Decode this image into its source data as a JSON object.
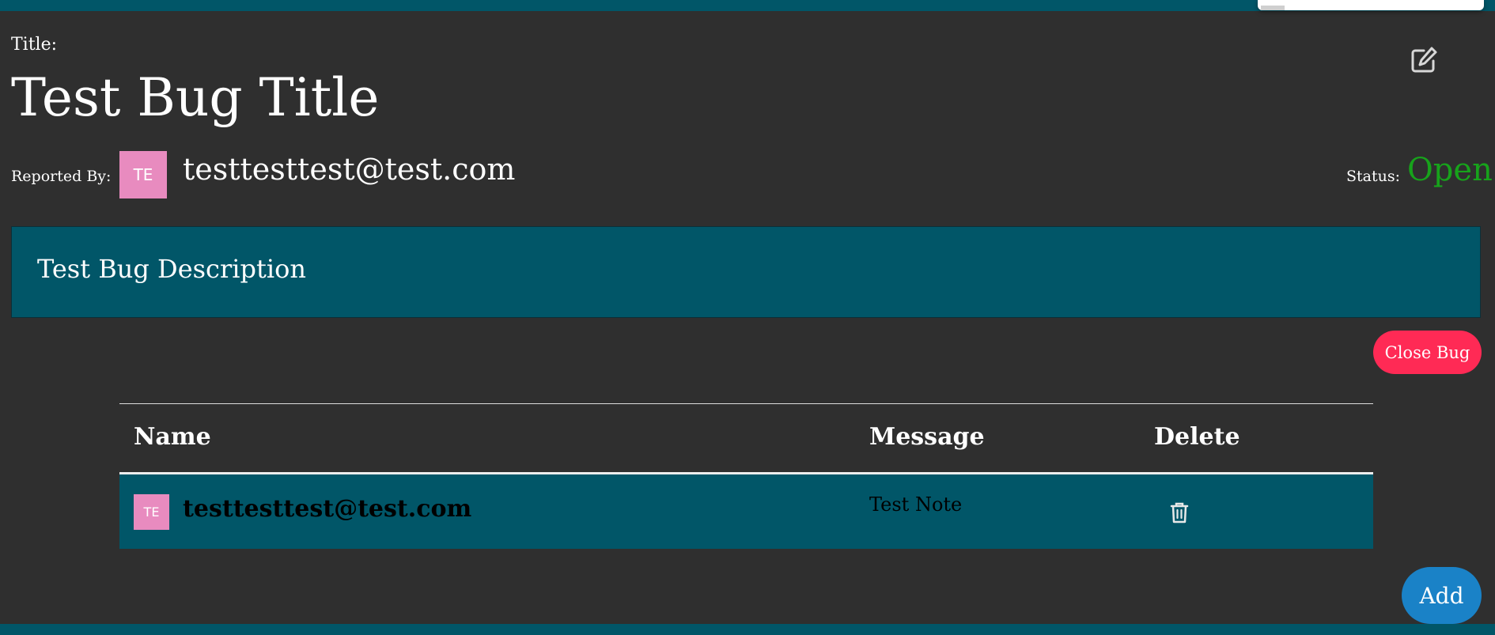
{
  "bug": {
    "title_label": "Title:",
    "title": "Test Bug Title",
    "reported_by_label": "Reported By:",
    "reporter_initials": "TE",
    "reporter_email": "testtesttest@test.com",
    "status_label": "Status:",
    "status": "Open",
    "description": "Test Bug Description"
  },
  "actions": {
    "close_label": "Close Bug",
    "add_label": "Add",
    "edit_icon": "edit-icon"
  },
  "notes": {
    "headers": [
      "Name",
      "Message",
      "Delete"
    ],
    "rows": [
      {
        "initials": "TE",
        "name": "testtesttest@test.com",
        "message": "Test Note",
        "delete_icon": "trash-icon"
      }
    ]
  },
  "colors": {
    "accent": "#015668",
    "status_open": "#17a31b",
    "close_button": "#ff2a55",
    "add_button": "#1a82c7",
    "avatar": "#e88bbf"
  }
}
